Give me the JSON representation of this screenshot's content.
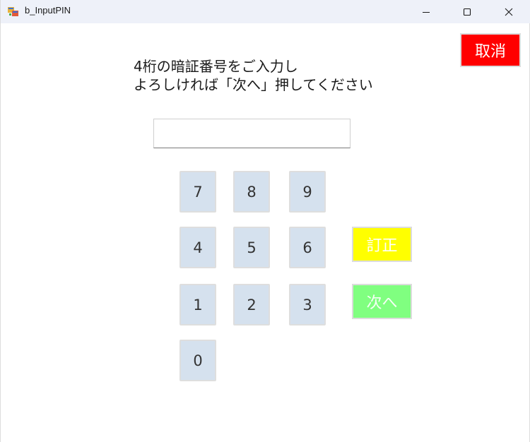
{
  "window": {
    "title": "b_InputPIN"
  },
  "instruction": {
    "line1": "4桁の暗証番号をご入力し",
    "line2": "よろしければ「次へ」押してください"
  },
  "pin_input": {
    "value": "",
    "placeholder": ""
  },
  "keypad": {
    "keys": [
      "7",
      "8",
      "9",
      "4",
      "5",
      "6",
      "1",
      "2",
      "3",
      "0"
    ]
  },
  "buttons": {
    "cancel_label": "取消",
    "correct_label": "訂正",
    "next_label": "次へ"
  },
  "colors": {
    "cancel": "#ff0000",
    "correct": "#ffff00",
    "next": "#80ff80",
    "key_face": "#d5e1ee"
  },
  "icons": [
    "app-icon",
    "minimize-icon",
    "maximize-icon",
    "close-icon"
  ]
}
